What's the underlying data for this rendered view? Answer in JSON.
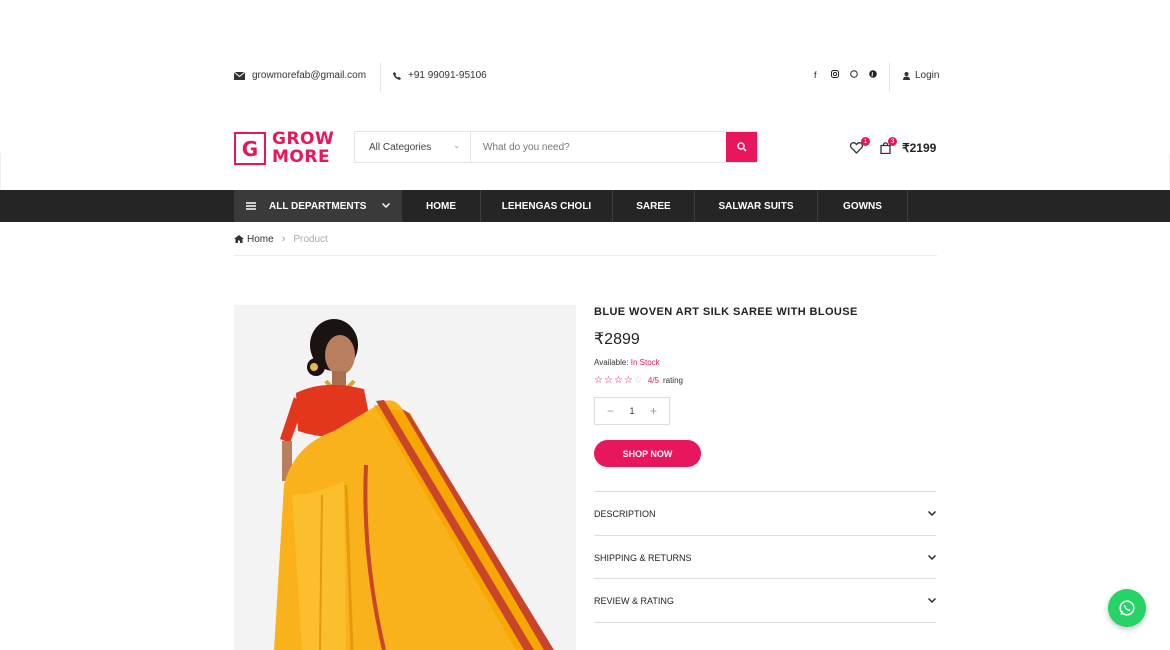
{
  "topbar": {
    "email": "growmorefab@gmail.com",
    "phone": "+91 99091-95106",
    "login": "Login"
  },
  "logo": {
    "letter": "G",
    "line1": "GROW",
    "line2": "MORE"
  },
  "search": {
    "category": "All Categories",
    "placeholder": "What do you need?"
  },
  "cart": {
    "wishlist_count": "1",
    "cart_count": "3",
    "total": "₹2199"
  },
  "nav": {
    "departments": "ALL DEPARTMENTS",
    "items": [
      "HOME",
      "LEHENGAS CHOLI",
      "SAREE",
      "SALWAR SUITS",
      "GOWNS"
    ]
  },
  "breadcrumb": {
    "home": "Home",
    "current": "Product"
  },
  "product": {
    "title": "BLUE WOVEN ART SILK SAREE WITH BLOUSE",
    "price": "₹2899",
    "availability_label": "Available:",
    "availability_value": "In Stock",
    "rating_value": "4/5",
    "rating_label": "rating",
    "rating_stars": 4,
    "quantity": "1",
    "shop_label": "SHOP NOW"
  },
  "accordion": [
    "DESCRIPTION",
    "SHIPPING & RETURNS",
    "REVIEW & RATING"
  ],
  "colors": {
    "accent": "#e8175d",
    "nav_bg": "#252525",
    "whatsapp": "#25d366"
  }
}
